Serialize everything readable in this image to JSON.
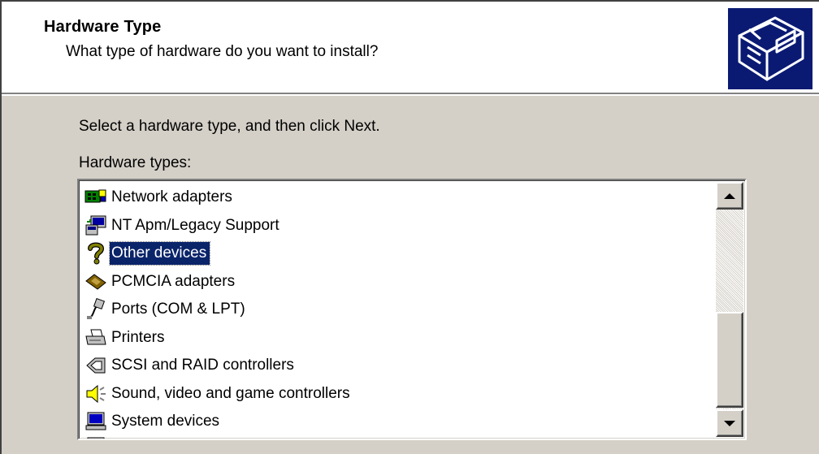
{
  "header": {
    "title": "Hardware Type",
    "subtitle": "What type of hardware do you want to install?",
    "art_icon": "hardware-wizard-icon"
  },
  "instruction": "Select a hardware type, and then click Next.",
  "list": {
    "label": "Hardware types:",
    "selected_index": 2,
    "items": [
      {
        "label": "Network adapters",
        "icon": "network-adapter-icon"
      },
      {
        "label": "NT Apm/Legacy Support",
        "icon": "legacy-support-icon"
      },
      {
        "label": "Other devices",
        "icon": "question-mark-icon"
      },
      {
        "label": "PCMCIA adapters",
        "icon": "pcmcia-card-icon"
      },
      {
        "label": "Ports (COM & LPT)",
        "icon": "port-cable-icon"
      },
      {
        "label": "Printers",
        "icon": "printer-icon"
      },
      {
        "label": "SCSI and RAID controllers",
        "icon": "scsi-icon"
      },
      {
        "label": "Sound, video and game controllers",
        "icon": "speaker-icon"
      },
      {
        "label": "System devices",
        "icon": "computer-monitor-icon"
      }
    ]
  },
  "colors": {
    "dialog_face": "#d4d0c8",
    "selection": "#0a246a",
    "wizard_art": "#0a1a73"
  }
}
